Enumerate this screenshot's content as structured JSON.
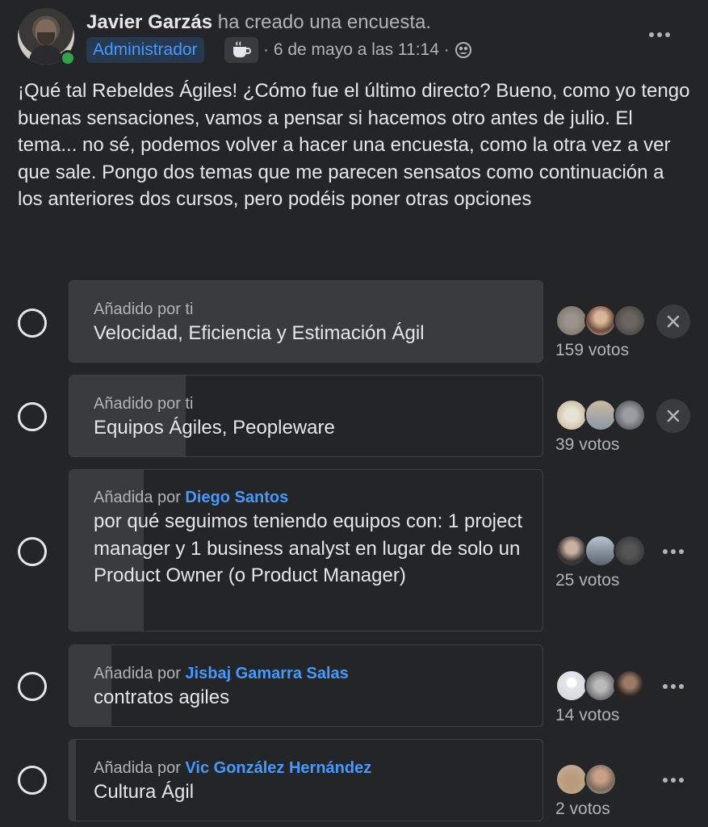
{
  "post": {
    "author": "Javier Garzás",
    "action": "ha creado una encuesta.",
    "badge": "Administrador",
    "timestamp": "· 6 de mayo a las 11:14 ·",
    "icons": [
      "coffee-icon",
      "globe-icon",
      "more-icon"
    ],
    "body": "¡Qué tal Rebeldes Ágiles! ¿Cómo fue el último directo? Bueno, como yo tengo buenas sensaciones, vamos a pensar si hacemos otro antes de julio. El tema... no sé, podemos volver a hacer una encuesta, como la otra vez a ver que sale. Pongo dos temas que me parecen sensatos como continuación a los anteriores dos cursos, pero podéis poner otras opciones"
  },
  "poll": {
    "options": [
      {
        "added_prefix": "Añadido por ti",
        "added_by": "",
        "label": "Velocidad, Eficiencia y Estimación Ágil",
        "votes": 159,
        "votes_label": "159 votos",
        "share": 1.0,
        "action": "remove"
      },
      {
        "added_prefix": "Añadido por ti",
        "added_by": "",
        "label": "Equipos Ágiles, Peopleware",
        "votes": 39,
        "votes_label": "39 votos",
        "share": 0.245,
        "action": "remove"
      },
      {
        "added_prefix": "Añadida por ",
        "added_by": "Diego Santos",
        "label": "por qué seguimos teniendo equipos con: 1 project manager y 1 business analyst en lugar de solo un Product Owner (o Product Manager)",
        "votes": 25,
        "votes_label": "25 votos",
        "share": 0.157,
        "action": "more"
      },
      {
        "added_prefix": "Añadida por ",
        "added_by": "Jisbaj Gamarra Salas",
        "label": "contratos agiles",
        "votes": 14,
        "votes_label": "14 votos",
        "share": 0.088,
        "action": "more"
      },
      {
        "added_prefix": "Añadida por ",
        "added_by": "Vic González Hernández",
        "label": "Cultura Ágil",
        "votes": 2,
        "votes_label": "2 votos",
        "share": 0.013,
        "action": "more"
      }
    ]
  },
  "colors": {
    "background": "#242526",
    "bar_fill": "#3a3b3c",
    "link_blue": "#4599ff",
    "online": "#31a24c"
  }
}
